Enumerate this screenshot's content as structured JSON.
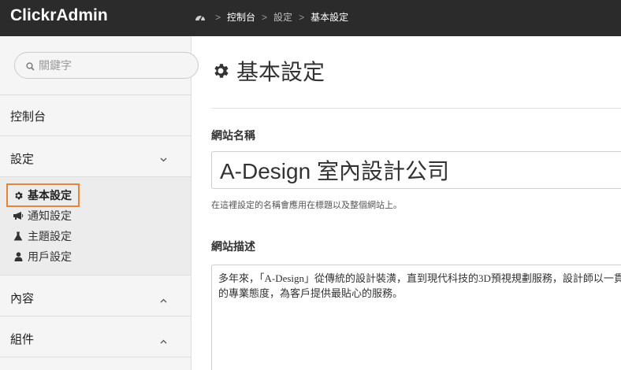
{
  "app": {
    "title": "ClickrAdmin"
  },
  "breadcrumb": {
    "items": [
      "控制台",
      "設定",
      "基本設定"
    ]
  },
  "search": {
    "placeholder": "關鍵字"
  },
  "sidebar": {
    "items": [
      {
        "label": "控制台"
      },
      {
        "label": "設定",
        "expanded": true,
        "chevron": "chevron-down-icon"
      },
      {
        "label": "內容",
        "expanded": false,
        "chevron": "chevron-up-icon"
      },
      {
        "label": "組件",
        "expanded": false,
        "chevron": "chevron-up-icon"
      }
    ],
    "submenu": [
      {
        "label": "基本設定",
        "icon": "gear-icon",
        "active": true
      },
      {
        "label": "通知設定",
        "icon": "bullhorn-icon"
      },
      {
        "label": "主題設定",
        "icon": "flask-icon"
      },
      {
        "label": "用戶設定",
        "icon": "user-icon"
      }
    ]
  },
  "page": {
    "title": "基本設定",
    "icon": "gear-icon"
  },
  "form": {
    "site_name": {
      "label": "網站名稱",
      "value": "A-Design 室內設計公司",
      "help": "在這裡設定的名稱會應用在標題以及整個網站上。"
    },
    "site_desc": {
      "label": "網站描述",
      "value": "多年來，「A-Design」從傳統的設計裝潢，直到現代科技的3D預視規劃服務，設計師以一貫的專業態度，為客戶提供最貼心的服務。"
    }
  },
  "colors": {
    "topbar": "#2b2b2b",
    "sidebar": "#f5f5f5",
    "active_outline": "#e8833a"
  }
}
